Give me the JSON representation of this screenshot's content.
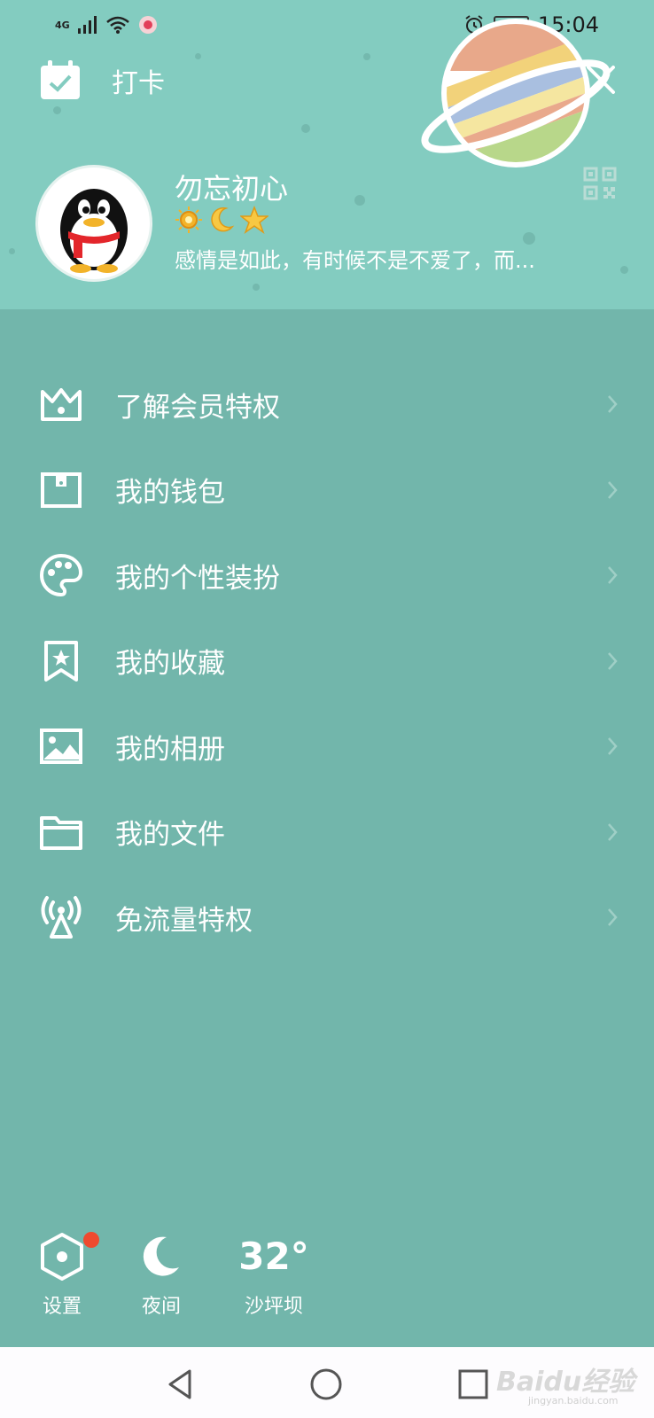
{
  "status_bar": {
    "network": "4G",
    "battery": "63",
    "time": "15:04"
  },
  "header": {
    "checkin_label": "打卡",
    "profile": {
      "name": "勿忘初心",
      "signature": "感情是如此，有时候不是不爱了，而..."
    }
  },
  "menu": {
    "items": [
      {
        "label": "了解会员特权",
        "icon": "crown-icon"
      },
      {
        "label": "我的钱包",
        "icon": "wallet-icon"
      },
      {
        "label": "我的个性装扮",
        "icon": "palette-icon"
      },
      {
        "label": "我的收藏",
        "icon": "bookmark-star-icon"
      },
      {
        "label": "我的相册",
        "icon": "image-icon"
      },
      {
        "label": "我的文件",
        "icon": "folder-icon"
      },
      {
        "label": "免流量特权",
        "icon": "signal-tower-icon"
      }
    ]
  },
  "bottom": {
    "settings_label": "设置",
    "night_label": "夜间",
    "temperature": "32°",
    "location": "沙坪坝"
  },
  "watermark": {
    "brand": "Baidu经验",
    "url": "jingyan.baidu.com"
  },
  "colors": {
    "header_bg": "#83ccc0",
    "body_bg": "#72b6ab",
    "notification_dot": "#ef4a2f",
    "navbar_bg": "#fdfcfe"
  }
}
